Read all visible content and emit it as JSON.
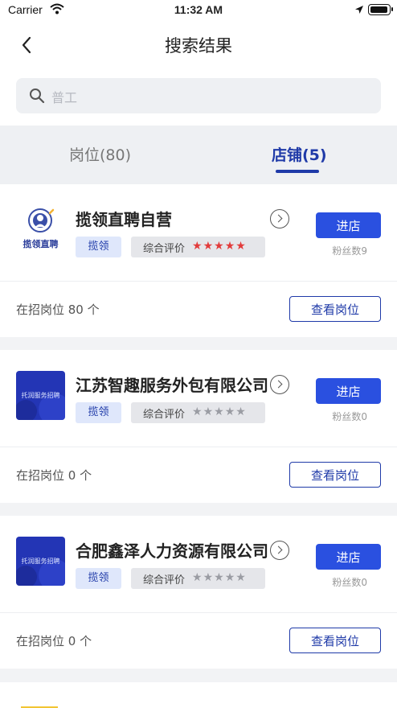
{
  "status_bar": {
    "carrier": "Carrier",
    "time": "11:32 AM"
  },
  "nav": {
    "title": "搜索结果"
  },
  "search": {
    "placeholder": "普工"
  },
  "tabs": [
    {
      "label": "岗位(80)",
      "active": false
    },
    {
      "label": "店铺(5)",
      "active": true
    }
  ],
  "shops": [
    {
      "logo_text": "揽领直聘",
      "name": "揽领直聘自营",
      "tag": "揽领",
      "rating_label": "综合评价",
      "rating": 5,
      "enter_label": "进店",
      "fans": "粉丝数9",
      "job_count_text": "在招岗位 80 个",
      "view_label": "查看岗位"
    },
    {
      "logo_text": "托润服务招聘",
      "name": "江苏智趣服务外包有限公司",
      "tag": "揽领",
      "rating_label": "综合评价",
      "rating": 0,
      "enter_label": "进店",
      "fans": "粉丝数0",
      "job_count_text": "在招岗位 0 个",
      "view_label": "查看岗位"
    },
    {
      "logo_text": "托润服务招聘",
      "name": "合肥鑫泽人力资源有限公司",
      "tag": "揽领",
      "rating_label": "综合评价",
      "rating": 0,
      "enter_label": "进店",
      "fans": "粉丝数0",
      "job_count_text": "在招岗位 0 个",
      "view_label": "查看岗位"
    }
  ],
  "colors": {
    "primary": "#2a50e0",
    "primary_dark": "#1f3aa8",
    "star_on": "#e23b3b",
    "star_off": "#9a9ca3"
  }
}
